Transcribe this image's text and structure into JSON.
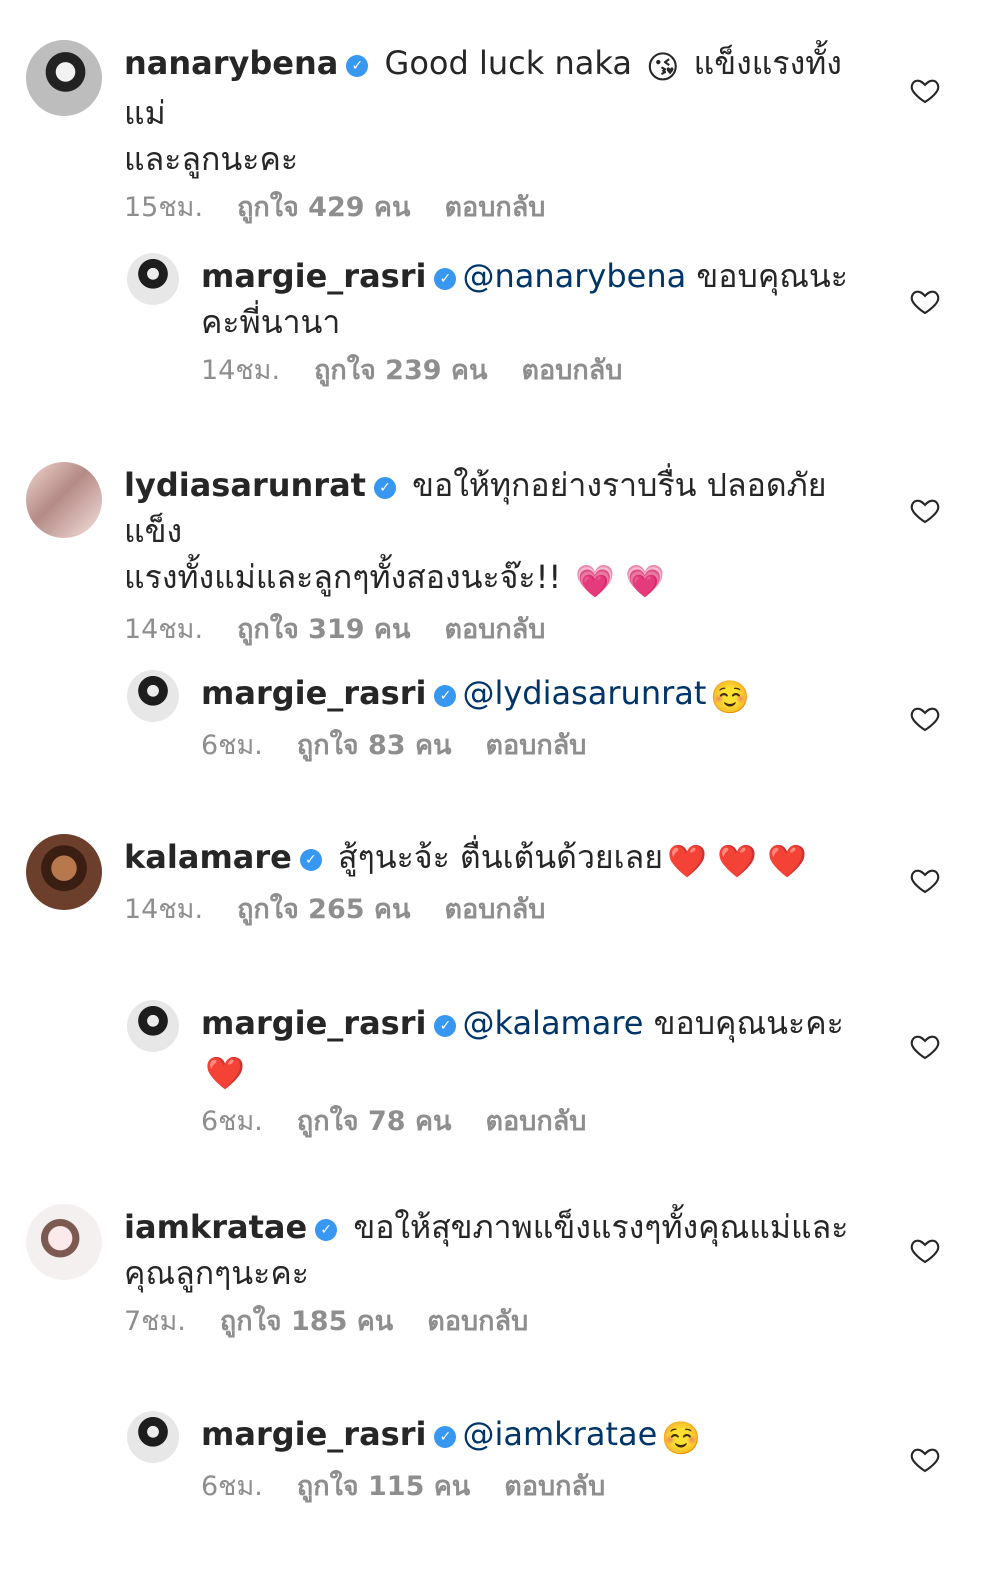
{
  "comments": [
    {
      "username": "nanarybena",
      "text_before_emoji": " Good luck naka ",
      "emoji": "😘",
      "text_after_emoji": " แข็งแรงทั้งแม่",
      "line2": "และลูกนะคะ",
      "time": "15ชม.",
      "likes": "ถูกใจ 429 คน",
      "reply_label": "ตอบกลับ"
    },
    {
      "username": "margie_rasri",
      "mention": "@nanarybena",
      "text": " ขอบคุณนะ",
      "line2": "คะพี่นานา",
      "time": "14ชม.",
      "likes": "ถูกใจ 239 คน",
      "reply_label": "ตอบกลับ"
    },
    {
      "username": "lydiasarunrat",
      "text": " ขอให้ทุกอย่างราบรื่น ปลอดภัยแข็ง",
      "line2": "แรงทั้งแม่และลูกๆทั้งสองนะจ๊ะ!! ",
      "emoji": "💗 💗",
      "time": "14ชม.",
      "likes": "ถูกใจ 319 คน",
      "reply_label": "ตอบกลับ"
    },
    {
      "username": "margie_rasri",
      "mention": "@lydiasarunrat",
      "emoji": "☺️",
      "time": "6ชม.",
      "likes": "ถูกใจ 83 คน",
      "reply_label": "ตอบกลับ"
    },
    {
      "username": "kalamare",
      "text": " สู้ๆนะจ้ะ ตื่นเต้นด้วยเลย",
      "emoji": "❤️ ❤️ ❤️",
      "time": "14ชม.",
      "likes": "ถูกใจ 265 คน",
      "reply_label": "ตอบกลับ"
    },
    {
      "username": "margie_rasri",
      "mention": "@kalamare",
      "text": " ขอบคุณนะคะ",
      "emoji": "❤️",
      "time": "6ชม.",
      "likes": "ถูกใจ 78 คน",
      "reply_label": "ตอบกลับ"
    },
    {
      "username": "iamkratae",
      "text": " ขอให้สุขภาพแข็งแรงๆทั้งคุณแม่และ",
      "line2": "คุณลูกๆนะคะ",
      "time": "7ชม.",
      "likes": "ถูกใจ 185 คน",
      "reply_label": "ตอบกลับ"
    },
    {
      "username": "margie_rasri",
      "mention": "@iamkratae",
      "emoji": "☺️",
      "time": "6ชม.",
      "likes": "ถูกใจ 115 คน",
      "reply_label": "ตอบกลับ"
    }
  ],
  "colors": {
    "verified": "#3897f0",
    "mention": "#003569",
    "meta": "#8e8e8e"
  },
  "icons": {
    "verified": "verified-badge-icon",
    "like": "heart-outline-icon"
  }
}
